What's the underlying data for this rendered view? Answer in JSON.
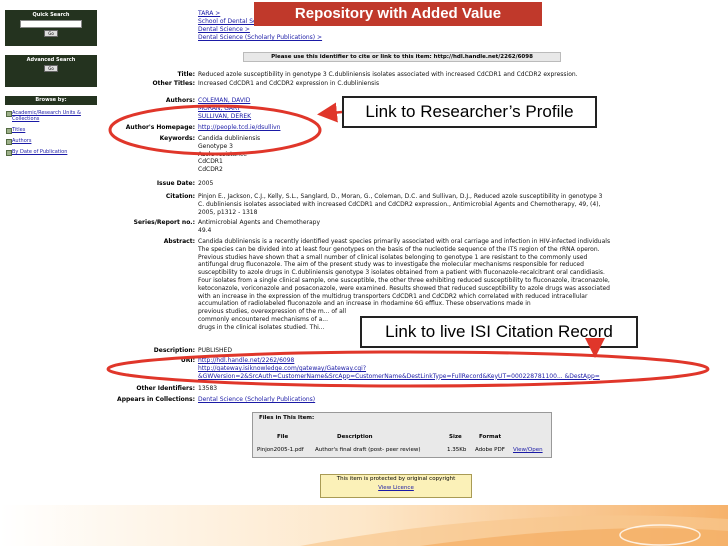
{
  "banner": {
    "title": "Repository with Added Value"
  },
  "sidebar": {
    "quick_search": {
      "title": "Quick Search",
      "go": "Go"
    },
    "advanced_search": {
      "title": "Advanced Search",
      "go": "Go"
    },
    "browse": {
      "title": "Browse by:",
      "items": [
        {
          "label": "Academic/Research Units & Collections"
        },
        {
          "label": "Titles"
        },
        {
          "label": "Authors"
        },
        {
          "label": "By Date of Publication"
        }
      ]
    }
  },
  "breadcrumb": [
    "TARA >",
    "School of Dental Sciences >",
    "Dental Science >",
    "Dental Science (Scholarly Publications) >"
  ],
  "handle_bar": {
    "text": "Please use this identifier to cite or link to this item: http://hdl.handle.net/2262/6098"
  },
  "item": {
    "title": {
      "label": "Title:",
      "value": "Reduced azole susceptibility in genotype 3 C.dubliniensis isolates associated with increased CdCDR1 and CdCDR2 expression."
    },
    "other_titles": {
      "label": "Other Titles:",
      "value": "Increased CdCDR1 and CdCDR2 expression in C.dubliniensis"
    },
    "authors": {
      "label": "Authors:",
      "values": [
        "COLEMAN, DAVID",
        "MORAN, GARY",
        "SULLIVAN, DEREK"
      ]
    },
    "homepage": {
      "label": "Author's Homepage:",
      "value": "http://people.tcd.ie/dsullivn"
    },
    "keywords": {
      "label": "Keywords:",
      "values": [
        "Candida dubliniensis",
        "Genotype 3",
        "Azole resistance",
        "CdCDR1",
        "CdCDR2"
      ]
    },
    "issue_date": {
      "label": "Issue Date:",
      "value": "2005"
    },
    "citation": {
      "label": "Citation:",
      "lines": [
        "Pinjon E., Jackson, C.J., Kelly, S.L., Sanglard, D., Moran, G., Coleman, D.C. and Sullivan, D.J., Reduced azole susceptibility in genotype 3",
        "C. dubliniensis isolates associated with increased CdCDR1 and CdCDR2 expression., Antimicrobial Agents and Chemotherapy, 49, (4),",
        "2005, p1312 - 1318"
      ]
    },
    "series": {
      "label": "Series/Report no.:",
      "values": [
        "Antimicrobial Agents and Chemotherapy",
        "49.4"
      ]
    },
    "abstract": {
      "label": "Abstract:",
      "lines": [
        "Candida dubliniensis is a recently identified yeast species primarily associated with oral carriage and infection in HIV-infected individuals",
        "The species can be divided into at least four genotypes on the basis of the nucleotide sequence of the ITS region of the rRNA operon.",
        "Previous studies have shown that a small number of clinical isolates belonging to genotype 1 are resistant to the commonly used",
        "antifungal drug fluconazole. The aim of the present study was to investigate the molecular mechanisms responsible for reduced",
        "susceptibility to azole drugs in C.dubliniensis genotype 3 isolates obtained from a patient with fluconazole-recalcitrant oral candidiasis.",
        "Four isolates from a single clinical sample, one susceptible, the other three exhibiting reduced susceptibility to fluconazole, itraconazole,",
        "ketoconazole, voriconazole and posaconazole, were examined. Results showed that reduced susceptibility to azole drugs was associated",
        "with an increase in the expression of the multidrug transporters CdCDR1 and CdCDR2 which correlated with reduced intracellular",
        "accumulation of radiolabeled fluconazole and an increase in rhodamine 6G efflux. These observations made in",
        "previous studies, overexpression of the m... of all",
        "commonly encountered mechanisms of a...",
        "drugs in the clinical isolates studied. Thi..."
      ]
    },
    "description": {
      "label": "Description:",
      "value": "PUBLISHED"
    },
    "uri": {
      "label": "URI:",
      "lines": [
        "http://hdl.handle.net/2262/6098",
        "http://gateway.isiknowledge.com/gateway/Gateway.cgi?",
        "&GWVersion=2&SrcAuth=CustomerName&SrcApp=CustomerName&DestLinkType=FullRecord&KeyUT=000228781100... &DestApp="
      ]
    },
    "other_identifiers": {
      "label": "Other Identifiers:",
      "value": "13583"
    },
    "collections": {
      "label": "Appears in Collections:",
      "value": "Dental Science (Scholarly Publications)"
    }
  },
  "files": {
    "title": "Files in This Item:",
    "headers": {
      "file": "File",
      "description": "Description",
      "size": "Size",
      "format": "Format"
    },
    "row": {
      "file": "Pinjon2005-1.pdf",
      "description": "Author's final draft (post- peer review)",
      "size": "1.35Kb",
      "format": "Adobe PDF",
      "view": "View/Open"
    }
  },
  "copyright": {
    "text": "This item is protected by original copyright",
    "link": "View Licence"
  },
  "callouts": {
    "profile": "Link to Researcher’s Profile",
    "isi": "Link to live ISI Citation Record"
  },
  "colors": {
    "banner": "#c0392b",
    "sidebar": "#24331f",
    "ellipse": "#e0362a"
  }
}
